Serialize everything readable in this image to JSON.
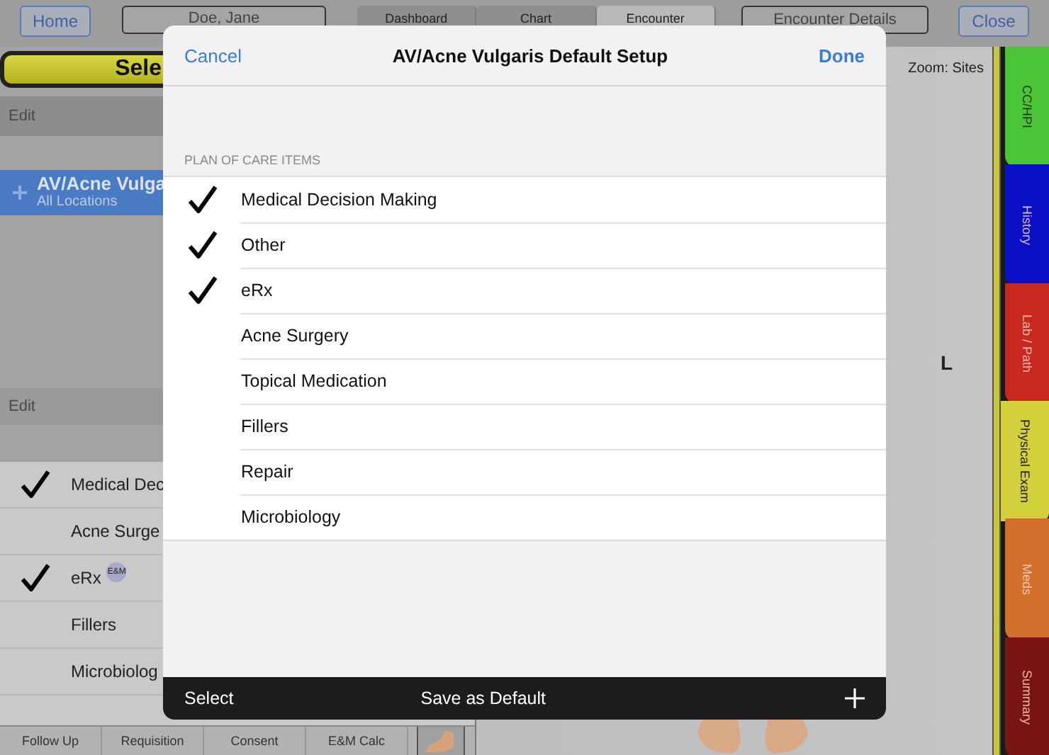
{
  "top_bar": {
    "home": "Home",
    "patient": "Doe, Jane",
    "segments": [
      {
        "label": "Dashboard",
        "selected": false
      },
      {
        "label": "Chart",
        "selected": false
      },
      {
        "label": "Encounter",
        "selected": true
      }
    ],
    "details": "Encounter Details",
    "close": "Close"
  },
  "left_panel": {
    "select_bar": "Sele",
    "edit_top": "Edit",
    "templates": [
      {
        "title": "AV/Acne Vulga",
        "subtitle": "All Locations",
        "selected": true
      }
    ],
    "edit_bottom": "Edit",
    "items": [
      {
        "label": "Medical Dec",
        "checked": true
      },
      {
        "label": "Acne Surge",
        "checked": false
      },
      {
        "label": "eRx",
        "checked": true,
        "badge": "E&M"
      },
      {
        "label": "Fillers",
        "checked": false
      },
      {
        "label": "Microbiolog",
        "checked": false
      }
    ],
    "bottom_tabs": [
      "Follow Up",
      "Requisition",
      "Consent",
      "E&M Calc"
    ]
  },
  "canvas": {
    "zoom_label": "Zoom: Sites",
    "side_label": "L"
  },
  "side_tabs": [
    {
      "label": "CC/HPI",
      "color": "#4cc43a",
      "selected": false
    },
    {
      "label": "History",
      "color": "#0a10c8",
      "selected": false
    },
    {
      "label": "Lab / Path",
      "color": "#c8281e",
      "selected": false
    },
    {
      "label": "Physical Exam",
      "color": "#d4d03c",
      "selected": true
    },
    {
      "label": "Meds",
      "color": "#d0702a",
      "selected": false
    },
    {
      "label": "Summary",
      "color": "#7a1410",
      "selected": false
    }
  ],
  "modal": {
    "cancel": "Cancel",
    "title": "AV/Acne Vulgaris Default Setup",
    "done": "Done",
    "section": "PLAN OF CARE ITEMS",
    "items": [
      {
        "label": "Medical Decision Making",
        "checked": true
      },
      {
        "label": "Other",
        "checked": true
      },
      {
        "label": "eRx",
        "checked": true
      },
      {
        "label": "Acne Surgery",
        "checked": false
      },
      {
        "label": "Topical Medication",
        "checked": false
      },
      {
        "label": "Fillers",
        "checked": false
      },
      {
        "label": "Repair",
        "checked": false
      },
      {
        "label": "Microbiology",
        "checked": false
      }
    ],
    "toolbar": {
      "select": "Select",
      "save": "Save as Default"
    }
  }
}
